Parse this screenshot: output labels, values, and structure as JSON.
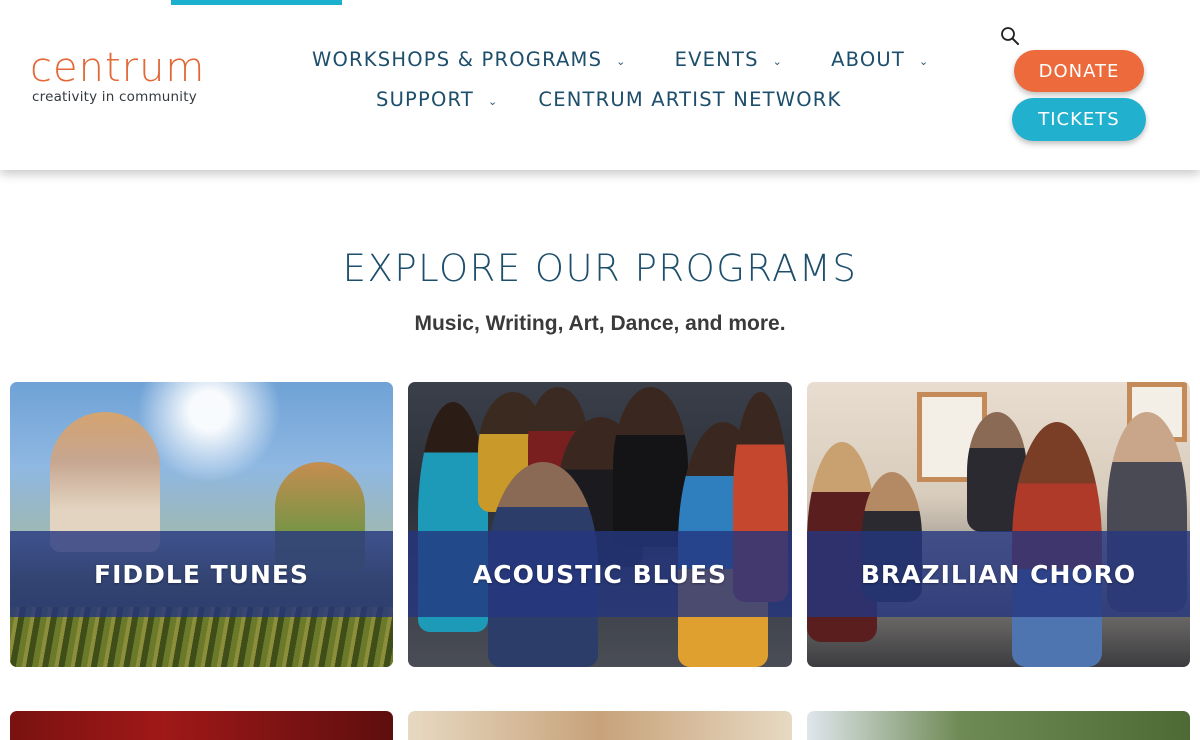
{
  "logo": {
    "wordmark": "centrum",
    "tagline": "creativity in community"
  },
  "nav": {
    "row1": [
      {
        "label": "WORKSHOPS & PROGRAMS",
        "has_dropdown": true
      },
      {
        "label": "EVENTS",
        "has_dropdown": true
      },
      {
        "label": "ABOUT",
        "has_dropdown": true
      }
    ],
    "row2": [
      {
        "label": "SUPPORT",
        "has_dropdown": true
      },
      {
        "label": "CENTRUM ARTIST NETWORK",
        "has_dropdown": false
      }
    ],
    "chevron": "⌄"
  },
  "actions": {
    "donate": "DONATE",
    "tickets": "TICKETS"
  },
  "section": {
    "title": "EXPLORE OUR PROGRAMS",
    "subtitle": "Music, Writing, Art, Dance, and more."
  },
  "cards": [
    {
      "label": "FIDDLE TUNES"
    },
    {
      "label": "ACOUSTIC BLUES"
    },
    {
      "label": "BRAZILIAN CHORO"
    }
  ],
  "icons": {
    "search": "search-icon",
    "dropdown": "chevron-down-icon"
  },
  "colors": {
    "brand_orange": "#e26838",
    "nav_text": "#1d4e6b",
    "donate": "#ec6a3b",
    "tickets": "#21b1cf",
    "active_bar": "#1cb0cf",
    "card_band": "#243680"
  }
}
